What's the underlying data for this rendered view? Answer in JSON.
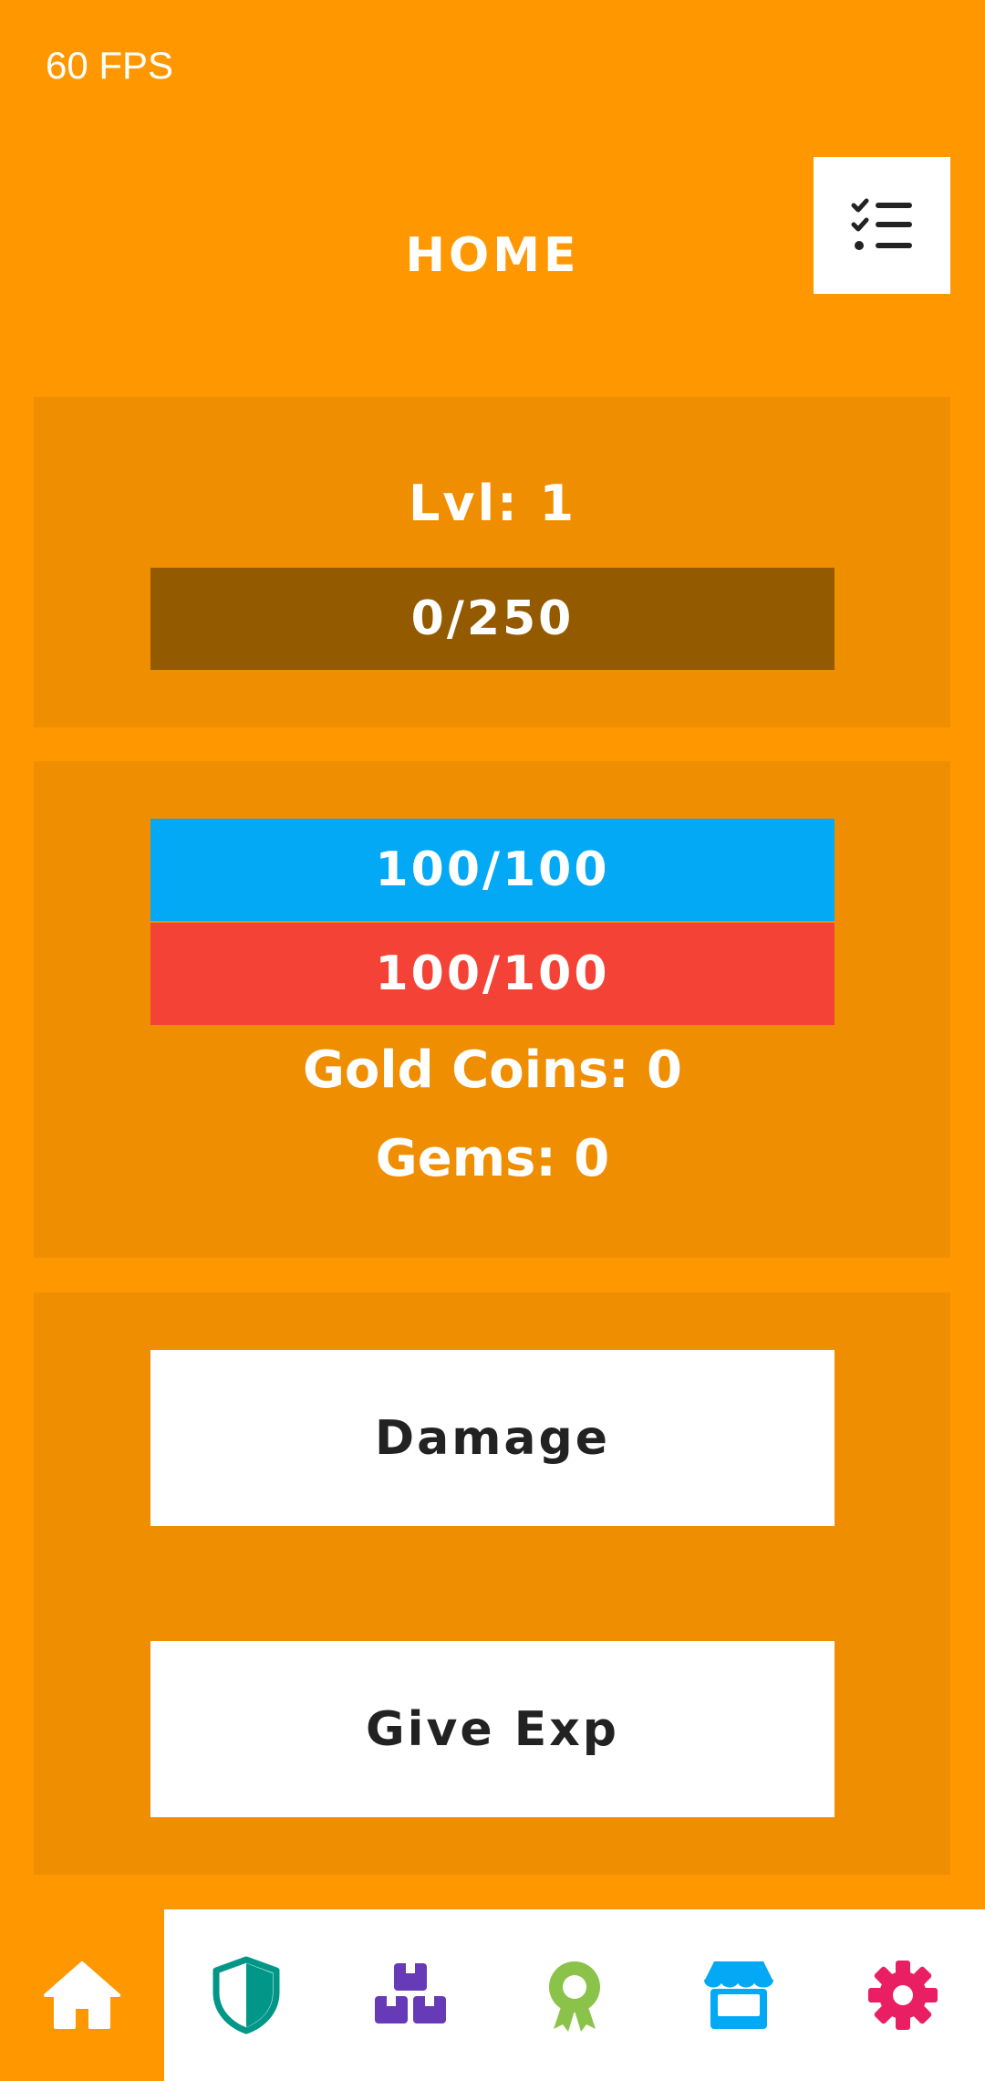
{
  "fps_counter": "60 FPS",
  "header": {
    "title": "HOME",
    "menu_icon": "checklist-icon"
  },
  "level_panel": {
    "level_label": "Lvl: 1",
    "exp_bar": {
      "text": "0/250",
      "fraction": 0.0
    }
  },
  "stats_panel": {
    "mana_bar": {
      "text": "100/100",
      "fraction": 1.0,
      "color": "#03A9F4"
    },
    "health_bar": {
      "text": "100/100",
      "fraction": 1.0,
      "color": "#F44336"
    },
    "gold_coins": "Gold Coins: 0",
    "gems": "Gems: 0"
  },
  "actions": {
    "damage_label": "Damage",
    "give_exp_label": "Give Exp"
  },
  "navbar": {
    "items": [
      {
        "icon": "home-icon",
        "color": "#FFFFFF",
        "active": true
      },
      {
        "icon": "shield-icon",
        "color": "#009688",
        "active": false
      },
      {
        "icon": "inventory-boxes-icon",
        "color": "#673AB7",
        "active": false
      },
      {
        "icon": "award-icon",
        "color": "#8BC34A",
        "active": false
      },
      {
        "icon": "store-icon",
        "color": "#03A9F4",
        "active": false
      },
      {
        "icon": "gear-icon",
        "color": "#E91E63",
        "active": false
      }
    ]
  },
  "colors": {
    "background": "#FF9800",
    "panel": "#EF8E00",
    "exp_bar_track": "#945A00",
    "mana": "#03A9F4",
    "health": "#F44336"
  }
}
